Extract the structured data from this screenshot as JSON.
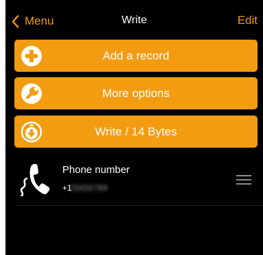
{
  "navbar": {
    "back_label": "Menu",
    "title": "Write",
    "edit_label": "Edit"
  },
  "actions": {
    "add_record_label": "Add a record",
    "more_options_label": "More options",
    "write_label": "Write / 14 Bytes"
  },
  "records": [
    {
      "title": "Phone number",
      "value_prefix": "+1",
      "value_hidden": "23456789",
      "icon": "phone-icon"
    }
  ],
  "icons": {
    "back": "chevron-left-icon",
    "add": "plus-circle-icon",
    "more": "wrench-icon",
    "write": "download-circle-icon",
    "reorder": "drag-handle-icon"
  },
  "colors": {
    "accent": "#f39c12",
    "background": "#000000",
    "text": "#ffffff"
  }
}
